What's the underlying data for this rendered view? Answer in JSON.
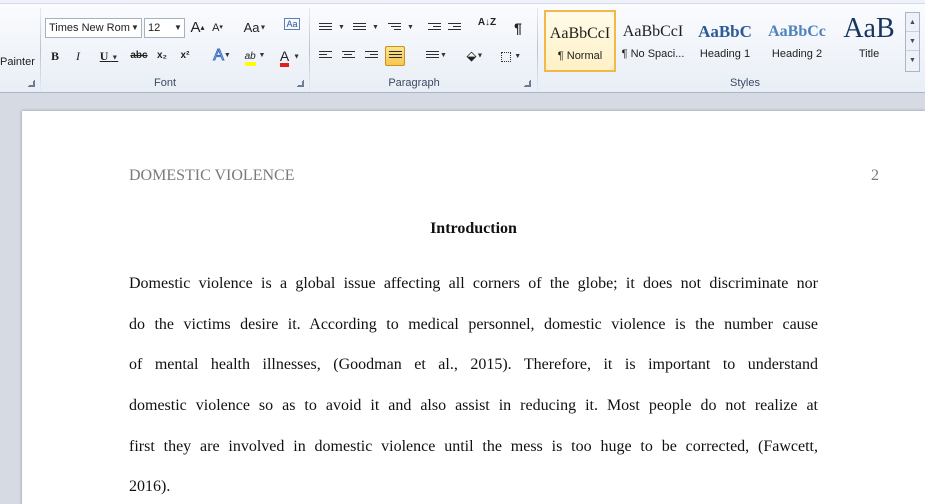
{
  "clipboard": {
    "painter_label": "Painter"
  },
  "font": {
    "group_label": "Font",
    "family": "Times New Rom",
    "size": "12",
    "grow": "A",
    "shrink": "A",
    "change_case": "Aa",
    "clear_format_glyph": "Aa",
    "bold": "B",
    "italic": "I",
    "underline": "U",
    "strikethrough": "abc",
    "subscript": "x₂",
    "superscript": "x²",
    "text_effects": "A",
    "highlight": "ab",
    "font_color": "A",
    "colors": {
      "highlight": "#ffff00",
      "font_color": "#e0201b",
      "text_effects": "#4f8ad6"
    }
  },
  "paragraph": {
    "group_label": "Paragraph",
    "sort": "A↓Z",
    "pilcrow": "¶",
    "active_alignment": "justify"
  },
  "styles": {
    "group_label": "Styles",
    "items": [
      {
        "preview": "AaBbCcI",
        "name": "¶ Normal",
        "selected": true
      },
      {
        "preview": "AaBbCcI",
        "name": "¶ No Spaci...",
        "selected": false
      },
      {
        "preview": "AaBbC",
        "name": "Heading 1",
        "selected": false
      },
      {
        "preview": "AaBbCc",
        "name": "Heading 2",
        "selected": false
      },
      {
        "preview": "AaB",
        "name": "Title",
        "selected": false
      }
    ]
  },
  "document": {
    "running_head": "DOMESTIC VIOLENCE",
    "page_number": "2",
    "title": "Introduction",
    "lines": [
      "Domestic violence is a global issue affecting all corners of the globe; it does not discriminate nor",
      "do the victims desire it. According to medical personnel, domestic violence is the number cause",
      "of mental health illnesses, (Goodman et al., 2015). Therefore, it is important to understand",
      "domestic violence so as to avoid it and also assist in reducing it. Most people do not realize at",
      "first they are involved in domestic violence until the mess is too huge to be corrected, (Fawcett,",
      "2016)."
    ]
  }
}
